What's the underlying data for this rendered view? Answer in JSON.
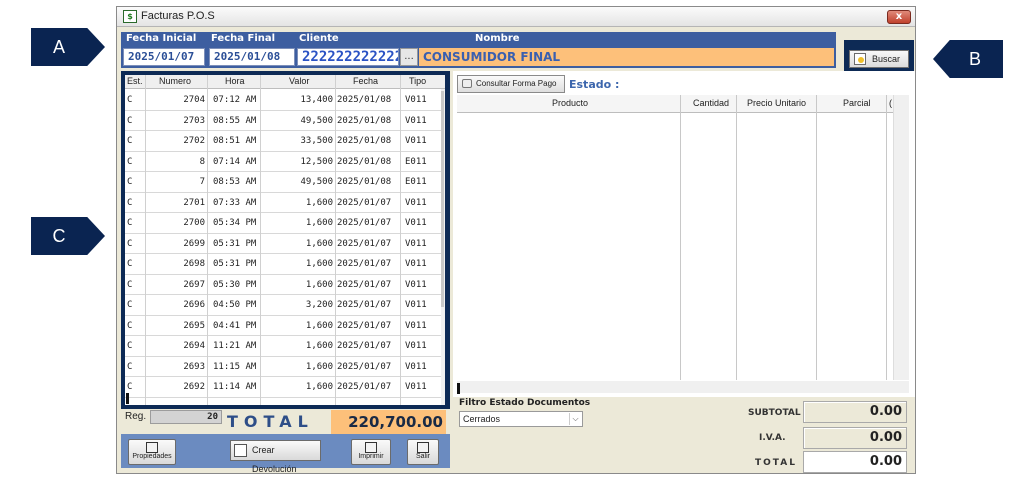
{
  "window": {
    "title": "Facturas P.O.S",
    "close_glyph": "x"
  },
  "filters": {
    "fecha_inicial_label": "Fecha Inicial",
    "fecha_final_label": "Fecha Final",
    "cliente_label": "Cliente",
    "nombre_label": "Nombre",
    "fecha_inicial": "2025/01/07",
    "fecha_final": "2025/01/08",
    "cliente": "222222222222",
    "dots": "...",
    "nombre": "CONSUMIDOR FINAL"
  },
  "buscar": {
    "label": "Buscar"
  },
  "left_table": {
    "columns": [
      "Est.",
      "Numero",
      "Hora",
      "Valor",
      "Fecha",
      "Tipo"
    ],
    "rows": [
      [
        "C",
        "2704",
        "07:12 AM",
        "13,400",
        "2025/01/08",
        "V011"
      ],
      [
        "C",
        "2703",
        "08:55 AM",
        "49,500",
        "2025/01/08",
        "V011"
      ],
      [
        "C",
        "2702",
        "08:51 AM",
        "33,500",
        "2025/01/08",
        "V011"
      ],
      [
        "C",
        "8",
        "07:14 AM",
        "12,500",
        "2025/01/08",
        "E011"
      ],
      [
        "C",
        "7",
        "08:53 AM",
        "49,500",
        "2025/01/08",
        "E011"
      ],
      [
        "C",
        "2701",
        "07:33 AM",
        "1,600",
        "2025/01/07",
        "V011"
      ],
      [
        "C",
        "2700",
        "05:34 PM",
        "1,600",
        "2025/01/07",
        "V011"
      ],
      [
        "C",
        "2699",
        "05:31 PM",
        "1,600",
        "2025/01/07",
        "V011"
      ],
      [
        "C",
        "2698",
        "05:31 PM",
        "1,600",
        "2025/01/07",
        "V011"
      ],
      [
        "C",
        "2697",
        "05:30 PM",
        "1,600",
        "2025/01/07",
        "V011"
      ],
      [
        "C",
        "2696",
        "04:50 PM",
        "3,200",
        "2025/01/07",
        "V011"
      ],
      [
        "C",
        "2695",
        "04:41 PM",
        "1,600",
        "2025/01/07",
        "V011"
      ],
      [
        "C",
        "2694",
        "11:21 AM",
        "1,600",
        "2025/01/07",
        "V011"
      ],
      [
        "C",
        "2693",
        "11:15 AM",
        "1,600",
        "2025/01/07",
        "V011"
      ],
      [
        "C",
        "2692",
        "11:14 AM",
        "1,600",
        "2025/01/07",
        "V011"
      ]
    ]
  },
  "footer_left": {
    "reg_label": "Reg.",
    "reg_value": "20",
    "total_label": "TOTAL",
    "total_value": "220,700.00"
  },
  "toolbar": {
    "propiedades": "Propiedades",
    "crear_devolucion": "Crear Devolución",
    "imprimir": "Imprimir",
    "salir": "Salir"
  },
  "right": {
    "consultar_forma_pago": "Consultar Forma Pago",
    "estado_label": "Estado :",
    "columns": [
      "Producto",
      "Cantidad",
      "Precio Unitario",
      "Parcial",
      "("
    ],
    "filtro_label": "Filtro Estado Documentos",
    "filtro_value": "Cerrados",
    "subtotal_label": "SUBTOTAL",
    "subtotal_value": "0.00",
    "iva_label": "I.V.A.",
    "iva_value": "0.00",
    "total_label": "TOTAL",
    "total_value": "0.00"
  },
  "callouts": {
    "a": "A",
    "b": "B",
    "c": "C"
  },
  "colors": {
    "header_band": "#3d5ea0",
    "accent_orange": "#fdc07a",
    "callout": "#0a2451"
  }
}
